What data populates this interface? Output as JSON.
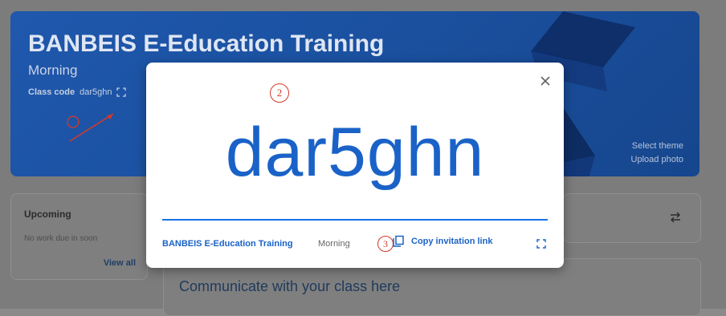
{
  "banner": {
    "title": "BANBEIS E-Education Training",
    "section": "Morning",
    "class_code_label": "Class code",
    "class_code": "dar5ghn",
    "select_theme": "Select theme",
    "upload_photo": "Upload photo",
    "annotation": "1"
  },
  "upcoming": {
    "title": "Upcoming",
    "empty": "No work due in soon",
    "view_all": "View all"
  },
  "stream": {
    "communicate": "Communicate with your class here"
  },
  "modal": {
    "annotation_top": "2",
    "code": "dar5ghn",
    "class_name": "BANBEIS E-Education Training",
    "section": "Morning",
    "annotation_copy": "3",
    "copy_label": "Copy invitation link"
  },
  "colors": {
    "accent": "#1a62c7",
    "annotation": "#d23a2a"
  },
  "icons": [
    "fullscreen-icon",
    "close-icon",
    "copy-icon",
    "swap-icon"
  ]
}
